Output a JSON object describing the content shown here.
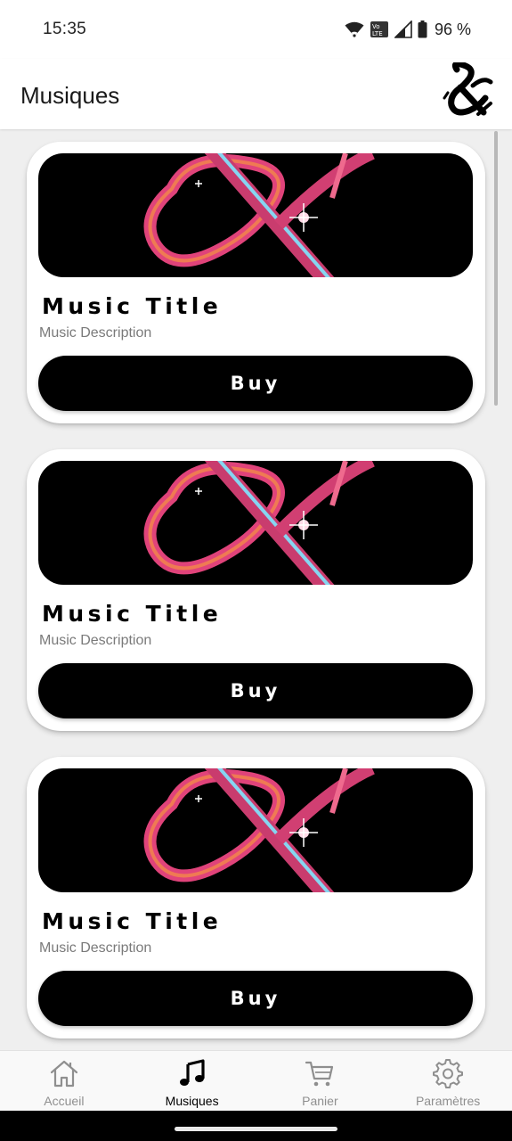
{
  "status_bar": {
    "time": "15:35",
    "battery": "96 %",
    "volte_badge": "Vo LTE"
  },
  "app_bar": {
    "title": "Musiques",
    "logo_icon": "ampersand-logo-icon"
  },
  "cards": [
    {
      "title": "Music Title",
      "description": "Music Description",
      "button_label": "Buy"
    },
    {
      "title": "Music Title",
      "description": "Music Description",
      "button_label": "Buy"
    },
    {
      "title": "Music Title",
      "description": "Music Description",
      "button_label": "Buy"
    }
  ],
  "bottom_nav": {
    "items": [
      {
        "label": "Accueil",
        "icon": "home-icon",
        "active": false
      },
      {
        "label": "Musiques",
        "icon": "music-note-icon",
        "active": true
      },
      {
        "label": "Panier",
        "icon": "cart-icon",
        "active": false
      },
      {
        "label": "Paramètres",
        "icon": "gear-icon",
        "active": false
      }
    ]
  },
  "colors": {
    "background": "#efefef",
    "card": "#ffffff",
    "button": "#000000",
    "nav_active": "#000000",
    "nav_inactive": "#8f8f8f",
    "art_pink": "#e0437a",
    "art_cyan": "#7fe6ff",
    "art_orange": "#f2884a"
  }
}
